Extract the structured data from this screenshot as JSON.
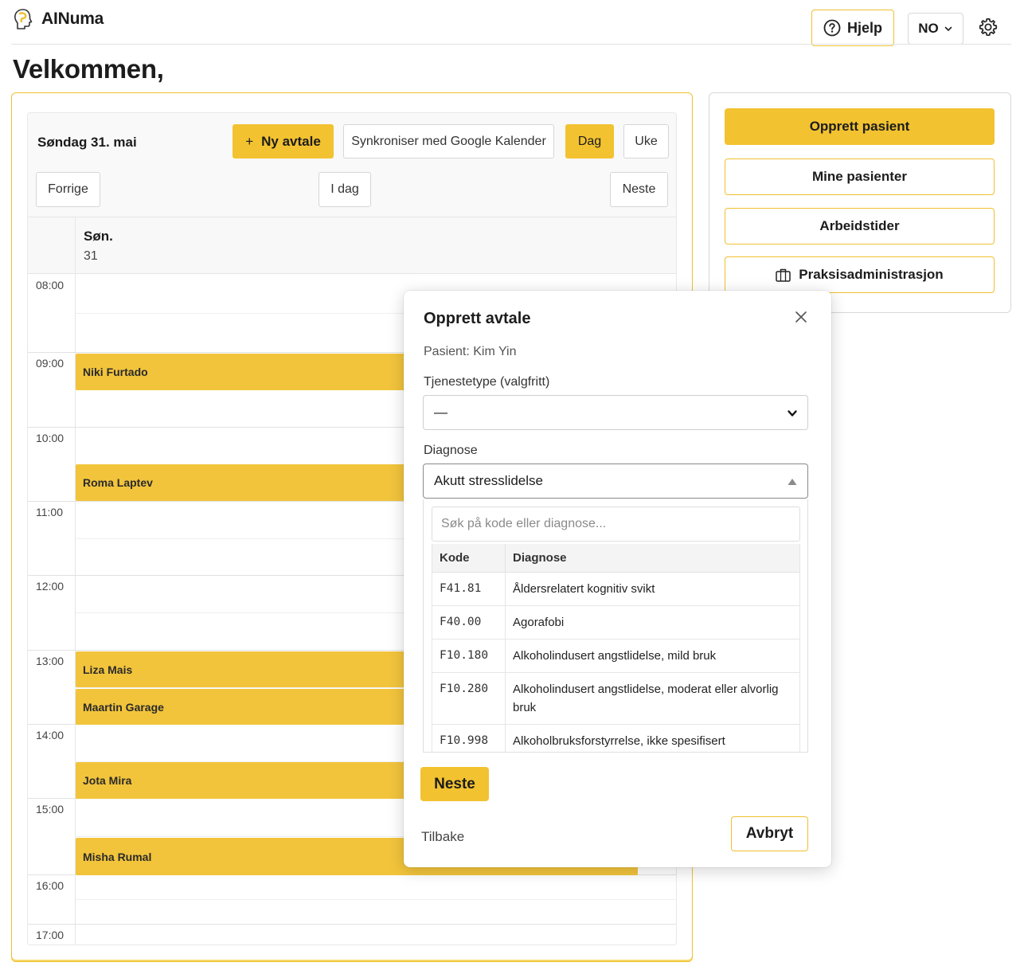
{
  "app": {
    "name": "AINuma"
  },
  "header": {
    "help_label": "Hjelp",
    "language": "NO"
  },
  "page": {
    "welcome": "Velkommen,"
  },
  "calendar": {
    "date_label": "Søndag 31. mai",
    "new_appointment_label": "Ny avtale",
    "new_appointment_icon": "+",
    "sync_label": "Synkroniser med Google Kalender",
    "view_day": "Dag",
    "view_week": "Uke",
    "prev_label": "Forrige",
    "today_label": "I dag",
    "next_label": "Neste",
    "day_name": "Søn.",
    "day_number": "31",
    "hours": [
      "08:00",
      "09:00",
      "10:00",
      "11:00",
      "12:00",
      "13:00",
      "14:00",
      "15:00",
      "16:00",
      "17:00"
    ],
    "events": [
      {
        "name": "Niki Furtado"
      },
      {
        "name": "Roma Laptev"
      },
      {
        "name": "Liza Mais"
      },
      {
        "name": "Maartin Garage"
      },
      {
        "name": "Jota Mira"
      },
      {
        "name": "Misha Rumal"
      }
    ]
  },
  "sidebar": {
    "create_patient": "Opprett pasient",
    "my_patients": "Mine pasienter",
    "work_hours": "Arbeidstider",
    "practice_admin": "Praksisadministrasjon"
  },
  "modal": {
    "title": "Opprett avtale",
    "patient_line": "Pasient: Kim Yin",
    "service_type_label": "Tjenestetype (valgfritt)",
    "service_type_value": "—",
    "diagnosis_label": "Diagnose",
    "diagnosis_value": "Akutt stresslidelse",
    "search_placeholder": "Søk på kode eller diagnose...",
    "table_headers": {
      "code": "Kode",
      "diagnosis": "Diagnose"
    },
    "rows": [
      {
        "code": "F41.81",
        "diagnosis": "Åldersrelatert kognitiv svikt"
      },
      {
        "code": "F40.00",
        "diagnosis": "Agorafobi"
      },
      {
        "code": "F10.180",
        "diagnosis": "Alkoholindusert angstlidelse, mild bruk"
      },
      {
        "code": "F10.280",
        "diagnosis": "Alkoholindusert angstlidelse, moderat eller alvorlig bruk"
      },
      {
        "code": "F10.998",
        "diagnosis": "Alkoholbruksforstyrrelse, ikke spesifisert"
      }
    ],
    "next_label": "Neste",
    "back_label": "Tilbake",
    "cancel_label": "Avbryt"
  },
  "colors": {
    "accent": "#f2c230",
    "event": "#f2c43c"
  }
}
